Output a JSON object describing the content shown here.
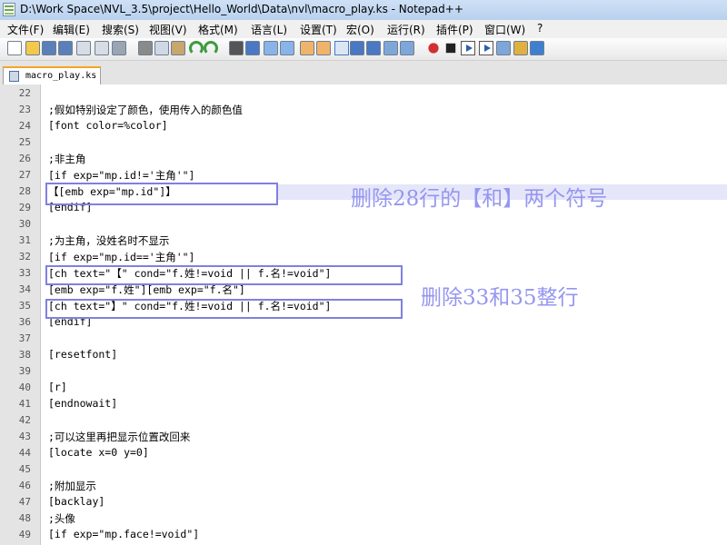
{
  "window": {
    "title": "D:\\Work Space\\NVL_3.5\\project\\Hello_World\\Data\\nvl\\macro_play.ks - Notepad++"
  },
  "menu": [
    "文件(F)",
    "编辑(E)",
    "搜索(S)",
    "视图(V)",
    "格式(M)",
    "语言(L)",
    "设置(T)",
    "宏(O)",
    "运行(R)",
    "插件(P)",
    "窗口(W)",
    "?"
  ],
  "tab": {
    "label": "macro_play.ks"
  },
  "lines": [
    {
      "n": "22",
      "text": ""
    },
    {
      "n": "23",
      "text": ";假如特别设定了颜色，使用传入的颜色值"
    },
    {
      "n": "24",
      "text": "[font color=%color]"
    },
    {
      "n": "25",
      "text": ""
    },
    {
      "n": "26",
      "text": ";非主角"
    },
    {
      "n": "27",
      "text": "[if exp=\"mp.id!='主角'\"]"
    },
    {
      "n": "28",
      "text": "【[emb exp=\"mp.id\"]】"
    },
    {
      "n": "29",
      "text": "[endif]"
    },
    {
      "n": "30",
      "text": ""
    },
    {
      "n": "31",
      "text": ";为主角，没姓名时不显示"
    },
    {
      "n": "32",
      "text": "[if exp=\"mp.id=='主角'\"]"
    },
    {
      "n": "33",
      "text": "[ch text=\"【\" cond=\"f.姓!=void || f.名!=void\"]"
    },
    {
      "n": "34",
      "text": "[emb exp=\"f.姓\"][emb exp=\"f.名\"]"
    },
    {
      "n": "35",
      "text": "[ch text=\"】\" cond=\"f.姓!=void || f.名!=void\"]"
    },
    {
      "n": "36",
      "text": "[endif]"
    },
    {
      "n": "37",
      "text": ""
    },
    {
      "n": "38",
      "text": "[resetfont]"
    },
    {
      "n": "39",
      "text": ""
    },
    {
      "n": "40",
      "text": "[r]"
    },
    {
      "n": "41",
      "text": "[endnowait]"
    },
    {
      "n": "42",
      "text": ""
    },
    {
      "n": "43",
      "text": ";可以这里再把显示位置改回来"
    },
    {
      "n": "44",
      "text": "[locate x=0 y=0]"
    },
    {
      "n": "45",
      "text": ""
    },
    {
      "n": "46",
      "text": ";附加显示"
    },
    {
      "n": "47",
      "text": "[backlay]"
    },
    {
      "n": "48",
      "text": ";头像"
    },
    {
      "n": "49",
      "text": "[if exp=\"mp.face!=void\"]"
    }
  ],
  "annotations": {
    "note1": "删除28行的【和】两个符号",
    "note2": "删除33和35整行"
  },
  "colors": {
    "annotation": "#9696f0",
    "highlight_border": "#8080e0",
    "tab_accent": "#f5a623"
  },
  "toolbar_icons": [
    "new-file-icon",
    "open-file-icon",
    "save-icon",
    "save-all-icon",
    "close-icon",
    "close-all-icon",
    "print-icon",
    "cut-icon",
    "copy-icon",
    "paste-icon",
    "undo-icon",
    "redo-icon",
    "find-icon",
    "replace-icon",
    "zoom-in-icon",
    "zoom-out-icon",
    "sync-v-icon",
    "sync-h-icon",
    "word-wrap-icon",
    "show-all-chars-icon",
    "indent-guide-icon",
    "doc-map-icon",
    "function-list-icon",
    "record-macro-icon",
    "stop-record-icon",
    "play-macro-icon",
    "run-macro-icon",
    "save-macro-icon",
    "spell-check-icon",
    "abc-check-icon"
  ]
}
